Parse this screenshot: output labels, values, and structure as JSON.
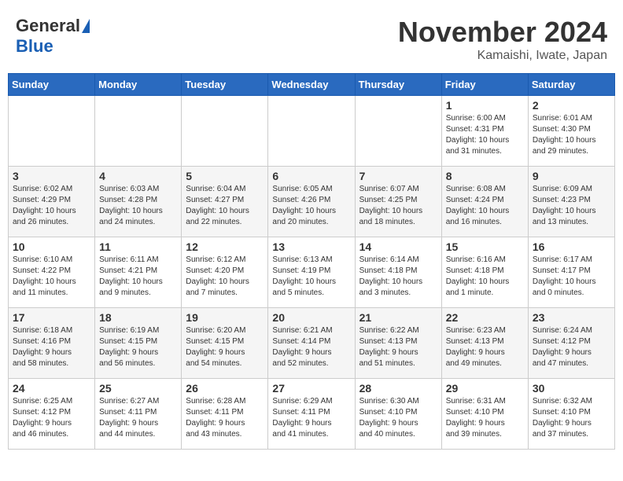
{
  "header": {
    "logo_general": "General",
    "logo_blue": "Blue",
    "month_title": "November 2024",
    "location": "Kamaishi, Iwate, Japan"
  },
  "weekdays": [
    "Sunday",
    "Monday",
    "Tuesday",
    "Wednesday",
    "Thursday",
    "Friday",
    "Saturday"
  ],
  "weeks": [
    [
      {
        "day": "",
        "info": ""
      },
      {
        "day": "",
        "info": ""
      },
      {
        "day": "",
        "info": ""
      },
      {
        "day": "",
        "info": ""
      },
      {
        "day": "",
        "info": ""
      },
      {
        "day": "1",
        "info": "Sunrise: 6:00 AM\nSunset: 4:31 PM\nDaylight: 10 hours\nand 31 minutes."
      },
      {
        "day": "2",
        "info": "Sunrise: 6:01 AM\nSunset: 4:30 PM\nDaylight: 10 hours\nand 29 minutes."
      }
    ],
    [
      {
        "day": "3",
        "info": "Sunrise: 6:02 AM\nSunset: 4:29 PM\nDaylight: 10 hours\nand 26 minutes."
      },
      {
        "day": "4",
        "info": "Sunrise: 6:03 AM\nSunset: 4:28 PM\nDaylight: 10 hours\nand 24 minutes."
      },
      {
        "day": "5",
        "info": "Sunrise: 6:04 AM\nSunset: 4:27 PM\nDaylight: 10 hours\nand 22 minutes."
      },
      {
        "day": "6",
        "info": "Sunrise: 6:05 AM\nSunset: 4:26 PM\nDaylight: 10 hours\nand 20 minutes."
      },
      {
        "day": "7",
        "info": "Sunrise: 6:07 AM\nSunset: 4:25 PM\nDaylight: 10 hours\nand 18 minutes."
      },
      {
        "day": "8",
        "info": "Sunrise: 6:08 AM\nSunset: 4:24 PM\nDaylight: 10 hours\nand 16 minutes."
      },
      {
        "day": "9",
        "info": "Sunrise: 6:09 AM\nSunset: 4:23 PM\nDaylight: 10 hours\nand 13 minutes."
      }
    ],
    [
      {
        "day": "10",
        "info": "Sunrise: 6:10 AM\nSunset: 4:22 PM\nDaylight: 10 hours\nand 11 minutes."
      },
      {
        "day": "11",
        "info": "Sunrise: 6:11 AM\nSunset: 4:21 PM\nDaylight: 10 hours\nand 9 minutes."
      },
      {
        "day": "12",
        "info": "Sunrise: 6:12 AM\nSunset: 4:20 PM\nDaylight: 10 hours\nand 7 minutes."
      },
      {
        "day": "13",
        "info": "Sunrise: 6:13 AM\nSunset: 4:19 PM\nDaylight: 10 hours\nand 5 minutes."
      },
      {
        "day": "14",
        "info": "Sunrise: 6:14 AM\nSunset: 4:18 PM\nDaylight: 10 hours\nand 3 minutes."
      },
      {
        "day": "15",
        "info": "Sunrise: 6:16 AM\nSunset: 4:18 PM\nDaylight: 10 hours\nand 1 minute."
      },
      {
        "day": "16",
        "info": "Sunrise: 6:17 AM\nSunset: 4:17 PM\nDaylight: 10 hours\nand 0 minutes."
      }
    ],
    [
      {
        "day": "17",
        "info": "Sunrise: 6:18 AM\nSunset: 4:16 PM\nDaylight: 9 hours\nand 58 minutes."
      },
      {
        "day": "18",
        "info": "Sunrise: 6:19 AM\nSunset: 4:15 PM\nDaylight: 9 hours\nand 56 minutes."
      },
      {
        "day": "19",
        "info": "Sunrise: 6:20 AM\nSunset: 4:15 PM\nDaylight: 9 hours\nand 54 minutes."
      },
      {
        "day": "20",
        "info": "Sunrise: 6:21 AM\nSunset: 4:14 PM\nDaylight: 9 hours\nand 52 minutes."
      },
      {
        "day": "21",
        "info": "Sunrise: 6:22 AM\nSunset: 4:13 PM\nDaylight: 9 hours\nand 51 minutes."
      },
      {
        "day": "22",
        "info": "Sunrise: 6:23 AM\nSunset: 4:13 PM\nDaylight: 9 hours\nand 49 minutes."
      },
      {
        "day": "23",
        "info": "Sunrise: 6:24 AM\nSunset: 4:12 PM\nDaylight: 9 hours\nand 47 minutes."
      }
    ],
    [
      {
        "day": "24",
        "info": "Sunrise: 6:25 AM\nSunset: 4:12 PM\nDaylight: 9 hours\nand 46 minutes."
      },
      {
        "day": "25",
        "info": "Sunrise: 6:27 AM\nSunset: 4:11 PM\nDaylight: 9 hours\nand 44 minutes."
      },
      {
        "day": "26",
        "info": "Sunrise: 6:28 AM\nSunset: 4:11 PM\nDaylight: 9 hours\nand 43 minutes."
      },
      {
        "day": "27",
        "info": "Sunrise: 6:29 AM\nSunset: 4:11 PM\nDaylight: 9 hours\nand 41 minutes."
      },
      {
        "day": "28",
        "info": "Sunrise: 6:30 AM\nSunset: 4:10 PM\nDaylight: 9 hours\nand 40 minutes."
      },
      {
        "day": "29",
        "info": "Sunrise: 6:31 AM\nSunset: 4:10 PM\nDaylight: 9 hours\nand 39 minutes."
      },
      {
        "day": "30",
        "info": "Sunrise: 6:32 AM\nSunset: 4:10 PM\nDaylight: 9 hours\nand 37 minutes."
      }
    ]
  ]
}
